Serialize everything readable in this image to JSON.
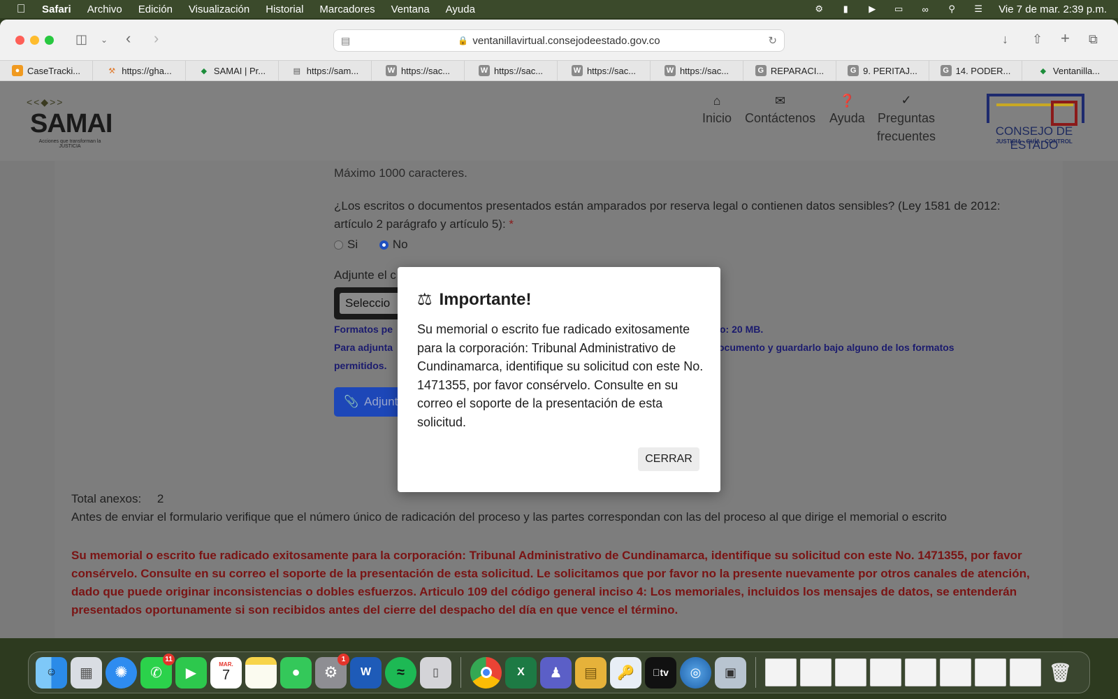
{
  "menubar": {
    "app_name": "Safari",
    "items": [
      "Archivo",
      "Edición",
      "Visualización",
      "Historial",
      "Marcadores",
      "Ventana",
      "Ayuda"
    ],
    "clock": "Vie 7 de mar.  2:39 p.m."
  },
  "browser": {
    "url": "ventanillavirtual.consejodeestado.gov.co",
    "bookmarks": [
      {
        "label": "CaseTracki...",
        "icon": "casetracking-icon"
      },
      {
        "label": "https://gha...",
        "icon": "gavel-icon"
      },
      {
        "label": "SAMAI | Pr...",
        "icon": "samai-icon"
      },
      {
        "label": "https://sam...",
        "icon": "document-icon"
      },
      {
        "label": "https://sac...",
        "icon": "w-icon"
      },
      {
        "label": "https://sac...",
        "icon": "w-icon"
      },
      {
        "label": "https://sac...",
        "icon": "w-icon"
      },
      {
        "label": "https://sac...",
        "icon": "w-icon"
      },
      {
        "label": "REPARACI...",
        "icon": "g-icon"
      },
      {
        "label": "9. PERITAJ...",
        "icon": "g-icon"
      },
      {
        "label": "14. PODER...",
        "icon": "g-icon"
      },
      {
        "label": "Ventanilla...",
        "icon": "samai-icon"
      }
    ]
  },
  "header": {
    "logo_text": "SAMAI",
    "logo_tagline": "Acciones que transforman la JUSTICIA",
    "nav": [
      "Inicio",
      "Contáctenos",
      "Ayuda",
      "Preguntas frecuentes"
    ],
    "ce_name": "CONSEJO DE ESTADO",
    "ce_sub": "JUSTICIA - GUÍA - CONTROL"
  },
  "form": {
    "max_chars": "Máximo 1000 caracteres.",
    "question": "¿Los escritos o documentos presentados están amparados por reserva legal o contienen datos sensibles? (Ley 1581 de 2012: artículo 2 parágrafo y artículo 5):",
    "required_mark": "*",
    "option_yes": "Si",
    "option_no": "No",
    "attach_label": "Adjunte el c",
    "select_text": "Seleccio",
    "formats_note_left": "Formatos pe",
    "formats_note_right": "o: 20 MB.",
    "attach_note_left": "Para adjunta",
    "attach_note_right": "ocumento y guardarlo bajo alguno de los formatos",
    "attach_note_end": "permitidos.",
    "attach_button": "Adjunt",
    "total_label": "Total anexos:",
    "total_value": "2",
    "verify_text": "Antes de enviar el formulario verifique que el número único de radicación del proceso y las partes correspondan con las del proceso al que dirige el memorial o escrito",
    "warning_text": "Su memorial o escrito fue radicado exitosamente para la corporación: Tribunal Administrativo de Cundinamarca, identifique su solicitud con este No. 1471355, por favor consérvelo. Consulte en su correo el soporte de la presentación de esta solicitud. Le solicitamos que por favor no la presente nuevamente por otros canales de atención, dado que puede originar inconsistencias o dobles esfuerzos. Articulo 109 del código general inciso 4: Los memoriales, incluidos los mensajes de datos, se entenderán presentados oportunamente si son recibidos antes del cierre del despacho del día en que vence el término."
  },
  "modal": {
    "title": "Importante!",
    "body": "Su memorial o escrito fue radicado exitosamente para la corporación: Tribunal Administrativo de Cundinamarca, identifique su solicitud con este No. 1471355, por favor consérvelo. Consulte en su correo el soporte de la presentación de esta solicitud.",
    "button": "CERRAR"
  },
  "dock": {
    "whatsapp_badge": "11",
    "settings_badge": "1",
    "calendar_month": "MAR.",
    "calendar_day": "7",
    "word_letter": "W",
    "excel_letter": "X",
    "appletv_label": "tv"
  }
}
